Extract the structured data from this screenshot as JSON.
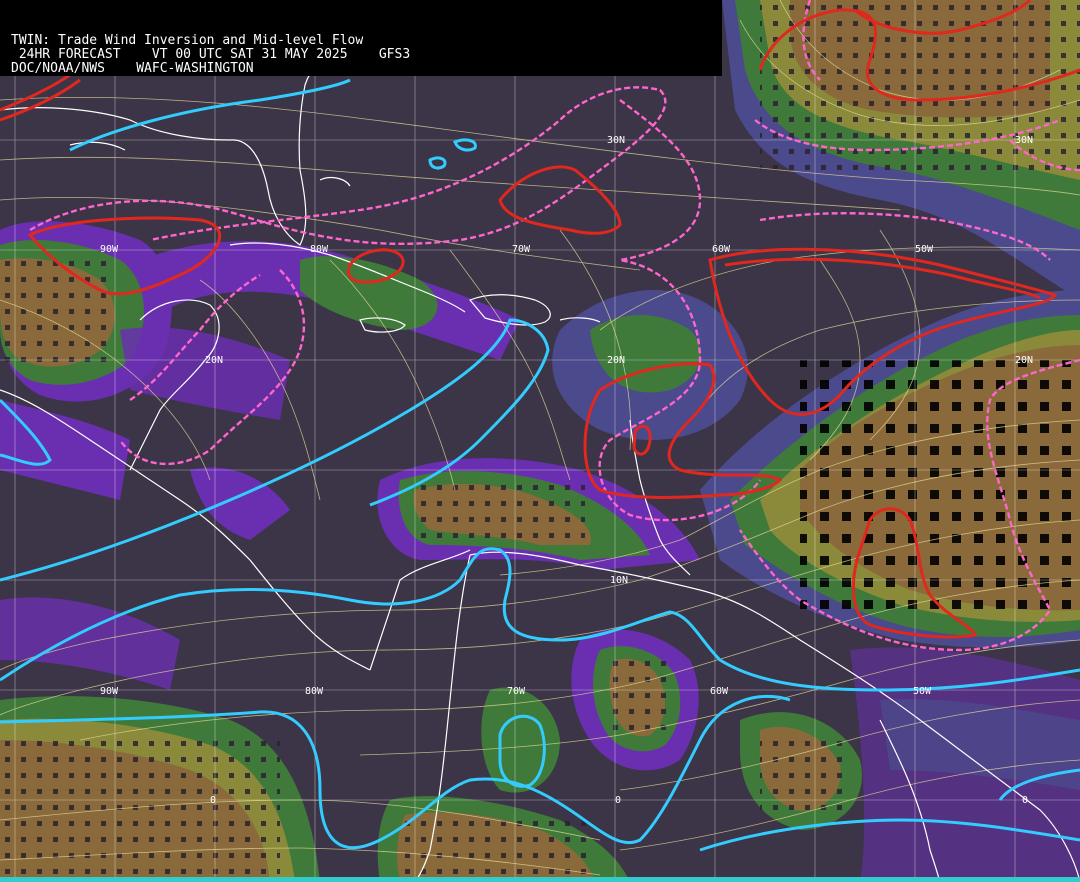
{
  "header": {
    "title": "TWIN: Trade Wind Inversion and Mid-level Flow",
    "forecast_line": " 24HR FORECAST    VT 00 UTC SAT 31 MAY 2025    GFS3",
    "agency_line": "DOC/NOAA/NWS    WAFC-WASHINGTON"
  },
  "grid_labels": {
    "lon_90w_upper": "90W",
    "lon_80w_upper": "80W",
    "lon_70w_upper": "70W",
    "lon_60w_upper": "60W",
    "lon_50w_upper": "50W",
    "lon_90w_lower": "90W",
    "lon_80w_lower": "80W",
    "lon_70w_lower": "70W",
    "lon_60w_lower": "60W",
    "lon_50w_lower": "50W",
    "lat_30n_left": "30N",
    "lat_30n_right": "30N",
    "lat_20n_left": "20N",
    "lat_20n_mid": "20N",
    "lat_20n_right": "20N",
    "lat_10n": "10N",
    "lat_0_a": "0",
    "lat_0_b": "0",
    "lat_0_c": "0"
  },
  "colors": {
    "background": "#3c3447",
    "purple_band": "#6a2fb0",
    "blue_band": "#4b4a8c",
    "green_band": "#3f7a3a",
    "olive_band": "#8a8a3a",
    "brown_band": "#8a6a3a",
    "dark_brown": "#7a5535",
    "red_contour": "#e0281e",
    "pink_dashed": "#ff66cc",
    "cyan_contour": "#33ccff",
    "coastline": "#ffffff",
    "streamline": "#e8dc9a",
    "grid": "#ffffff"
  },
  "legend_icons": [
    "coastline-icon",
    "streamline-icon",
    "contour-icon"
  ]
}
